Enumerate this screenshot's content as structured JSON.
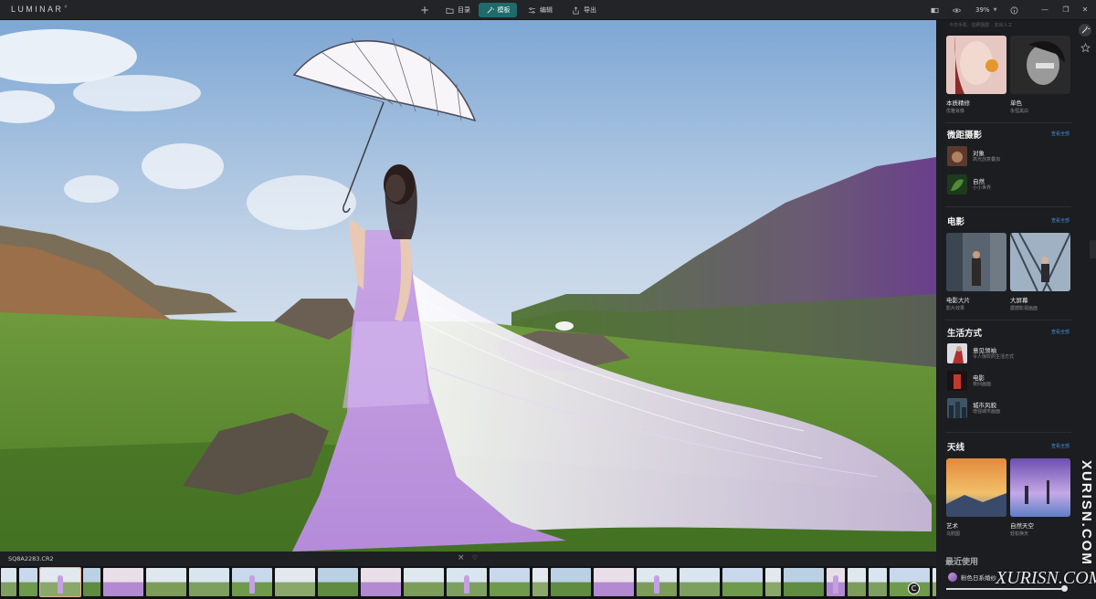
{
  "app": {
    "logo_text": "LUMINAR",
    "logo_version": "4"
  },
  "toolbar": {
    "add_label": "+",
    "catalog_label": "目录",
    "templates_label": "模板",
    "edit_label": "编辑",
    "export_label": "导出",
    "zoom_label": "39%",
    "accent_color": "#1f6b6b"
  },
  "panel": {
    "top_sub": "今日手机 · 拍照摄影 · 去出人工",
    "portrait": {
      "cards": [
        {
          "name": "本质精修",
          "desc": "优雅肖像"
        },
        {
          "name": "单色",
          "desc": "永恒黑白"
        }
      ]
    },
    "macro": {
      "title": "微距摄影",
      "see_all": "查看全部",
      "items": [
        {
          "name": "对象",
          "desc": "高光创意叠加"
        },
        {
          "name": "自然",
          "desc": "小小世界"
        }
      ]
    },
    "film": {
      "title": "电影",
      "see_all": "查看全部",
      "cards": [
        {
          "name": "电影大片",
          "desc": "影片效果"
        },
        {
          "name": "大屏幕",
          "desc": "震撼影视画面"
        }
      ]
    },
    "lifestyle": {
      "title": "生活方式",
      "see_all": "查看全部",
      "items": [
        {
          "name": "意见领袖",
          "desc": "令人惊叹的生活方式"
        },
        {
          "name": "电影",
          "desc": "夜间画面"
        },
        {
          "name": "城市风貌",
          "desc": "增强城市画面"
        }
      ]
    },
    "sky": {
      "title": "天线",
      "see_all": "查看全部",
      "cards": [
        {
          "name": "艺术",
          "desc": "乌鸦图"
        },
        {
          "name": "自然天空",
          "desc": "轻松换天"
        }
      ]
    },
    "recent": {
      "title": "最近使用",
      "item": "粉色日系婚纱",
      "progress": 0.97
    }
  },
  "filmstrip": {
    "current_file": "SQ8A2283.CR2",
    "frame_count": 40
  },
  "watermark": {
    "vertical": "XURISN.COM",
    "horizontal": "XURISN.COM"
  }
}
